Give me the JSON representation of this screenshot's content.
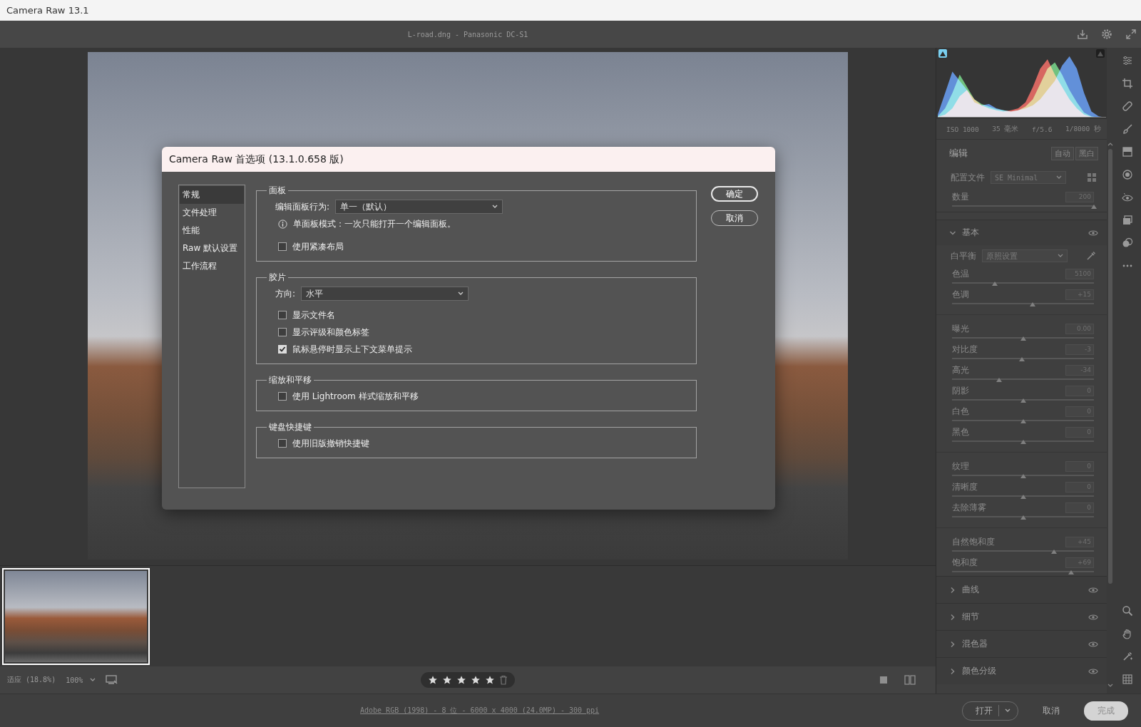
{
  "window": {
    "title": "Camera Raw 13.1"
  },
  "toolbar": {
    "file_info": "L-road.dng - Panasonic DC-S1"
  },
  "dialog": {
    "title": "Camera Raw 首选项 (13.1.0.658 版)",
    "nav": [
      {
        "label": "常规",
        "selected": true
      },
      {
        "label": "文件处理",
        "selected": false
      },
      {
        "label": "性能",
        "selected": false
      },
      {
        "label": "Raw 默认设置",
        "selected": false
      },
      {
        "label": "工作流程",
        "selected": false
      }
    ],
    "groups": [
      {
        "title": "面板",
        "rows": [
          {
            "kind": "select",
            "label": "编辑面板行为:",
            "value": "单一（默认）"
          },
          {
            "kind": "info",
            "text": "单面板模式：一次只能打开一个编辑面板。"
          },
          {
            "kind": "checkbox",
            "label": "使用紧凑布局",
            "checked": false
          }
        ]
      },
      {
        "title": "胶片",
        "rows": [
          {
            "kind": "select",
            "label": "方向:",
            "value": "水平"
          },
          {
            "kind": "checkbox",
            "label": "显示文件名",
            "checked": false
          },
          {
            "kind": "checkbox",
            "label": "显示评级和颜色标签",
            "checked": false
          },
          {
            "kind": "checkbox",
            "label": "鼠标悬停时显示上下文菜单提示",
            "checked": true
          }
        ]
      },
      {
        "title": "缩放和平移",
        "rows": [
          {
            "kind": "checkbox",
            "label": "使用 Lightroom 样式缩放和平移",
            "checked": false
          }
        ]
      },
      {
        "title": "键盘快捷键",
        "rows": [
          {
            "kind": "checkbox",
            "label": "使用旧版撤销快捷键",
            "checked": false
          }
        ]
      }
    ],
    "buttons": [
      "确定",
      "取消"
    ]
  },
  "histogram": {
    "series": [
      {
        "name": "blue",
        "color": "#3f7fe6",
        "values": [
          5,
          40,
          75,
          60,
          45,
          25,
          20,
          22,
          15,
          12,
          10,
          12,
          15,
          20,
          30,
          45,
          60,
          85,
          100,
          80,
          40,
          10,
          2,
          0
        ]
      },
      {
        "name": "green",
        "color": "#52c468",
        "values": [
          2,
          15,
          40,
          70,
          50,
          30,
          22,
          18,
          14,
          12,
          10,
          12,
          18,
          30,
          55,
          80,
          90,
          70,
          45,
          25,
          8,
          2,
          0,
          0
        ]
      },
      {
        "name": "red",
        "color": "#e2463e",
        "values": [
          1,
          5,
          15,
          35,
          45,
          30,
          20,
          15,
          12,
          10,
          12,
          15,
          25,
          50,
          80,
          95,
          70,
          50,
          30,
          15,
          5,
          1,
          0,
          0
        ]
      }
    ]
  },
  "camera_info": [
    "ISO 1000",
    "35 毫米",
    "f/5.6",
    "1/8000 秒"
  ],
  "edit": {
    "title": "编辑",
    "buttons": [
      "自动",
      "黑白"
    ],
    "profile": {
      "label": "配置文件",
      "value": "SE Minimal"
    },
    "amount": {
      "label": "数量",
      "value": "200",
      "level": 1.0
    }
  },
  "basic": {
    "title": "基本",
    "expanded": true,
    "white_balance": {
      "label": "白平衡",
      "value": "原照设置"
    },
    "slider_groups": [
      [
        {
          "label": "色温",
          "value": "5100",
          "level": 0.3
        },
        {
          "label": "色调",
          "value": "+15",
          "level": 0.57
        }
      ],
      [
        {
          "label": "曝光",
          "value": "0.00",
          "level": 0.5
        },
        {
          "label": "对比度",
          "value": "-3",
          "level": 0.49
        },
        {
          "label": "高光",
          "value": "-34",
          "level": 0.33
        },
        {
          "label": "阴影",
          "value": "0",
          "level": 0.5
        },
        {
          "label": "白色",
          "value": "0",
          "level": 0.5
        },
        {
          "label": "黑色",
          "value": "0",
          "level": 0.5
        }
      ],
      [
        {
          "label": "纹理",
          "value": "0",
          "level": 0.5
        },
        {
          "label": "清晰度",
          "value": "0",
          "level": 0.5
        },
        {
          "label": "去除薄雾",
          "value": "0",
          "level": 0.5
        }
      ],
      [
        {
          "label": "自然饱和度",
          "value": "+45",
          "level": 0.72
        },
        {
          "label": "饱和度",
          "value": "+69",
          "level": 0.84
        }
      ]
    ]
  },
  "sections": [
    {
      "title": "曲线",
      "expanded": false
    },
    {
      "title": "细节",
      "expanded": false
    },
    {
      "title": "混色器",
      "expanded": false
    },
    {
      "title": "颜色分级",
      "expanded": false
    }
  ],
  "filmstrip": {
    "items": [
      {
        "selected": true
      }
    ]
  },
  "status": {
    "zoom_fit": "适应 (18.8%)",
    "zoom": "100%",
    "rating": {
      "stars": 5,
      "max": 5
    }
  },
  "footer": {
    "info": "Adobe RGB (1998) - 8 位 - 6000 x 4000 (24.0MP) - 300 ppi",
    "buttons": [
      {
        "label": "打开",
        "kind": "split",
        "disabled": false
      },
      {
        "label": "取消",
        "kind": "text",
        "disabled": false
      },
      {
        "label": "完成",
        "kind": "primary",
        "disabled": true
      }
    ]
  }
}
